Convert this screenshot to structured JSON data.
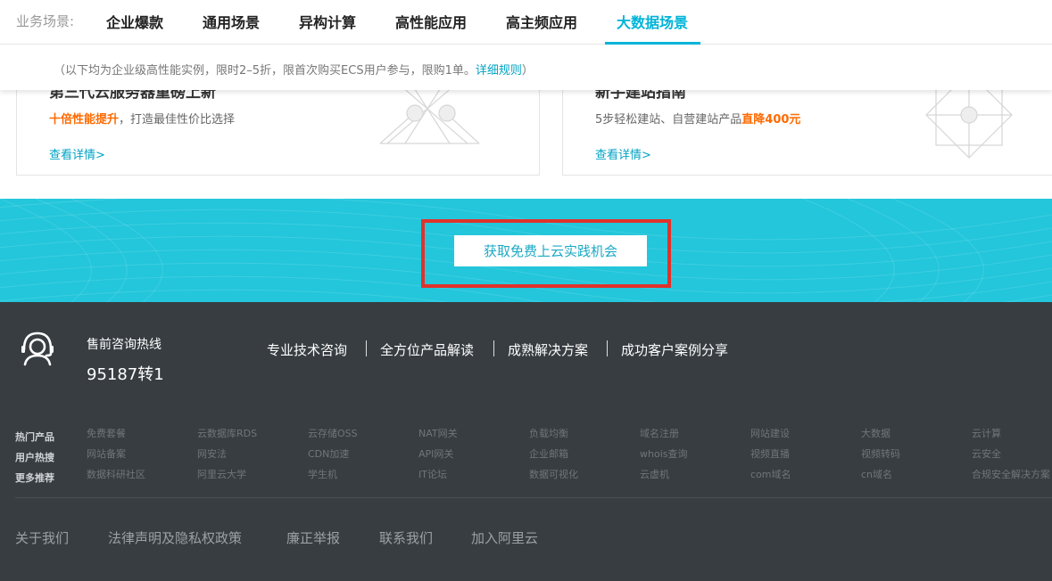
{
  "scenario_nav": {
    "label": "业务场景:",
    "tabs": [
      "企业爆款",
      "通用场景",
      "异构计算",
      "高性能应用",
      "高主频应用",
      "大数据场景"
    ],
    "active_tab": "大数据场景"
  },
  "notice": {
    "text": "（以下均为企业级高性能实例，限时2–5折，限首次购买ECS用户参与，限购1单。",
    "link": "详细规则",
    "suffix": "）"
  },
  "cards": [
    {
      "title": "第三代云服务器重磅上新",
      "desc_highlight": "十倍性能提升",
      "desc_rest": "，打造最佳性价比选择",
      "link": "查看详情>"
    },
    {
      "title": "新手建站指南",
      "desc_rest": "5步轻松建站、自营建站产品",
      "desc_highlight": "直降400元",
      "link": "查看详情>"
    }
  ],
  "cta": {
    "button_label": "获取免费上云实践机会"
  },
  "footer": {
    "hotline_label": "售前咨询热线",
    "hotline_number": "95187转1",
    "services": [
      "专业技术咨询",
      "全方位产品解读",
      "成熟解决方案",
      "成功客户案例分享"
    ],
    "categories": [
      "热门产品",
      "用户热搜",
      "更多推荐"
    ],
    "link_rows": [
      [
        "免费套餐",
        "云数据库RDS",
        "云存储OSS",
        "NAT网关",
        "负载均衡",
        "域名注册",
        "网站建设",
        "大数据",
        "云计算"
      ],
      [
        "网站备案",
        "网安法",
        "CDN加速",
        "API网关",
        "企业邮箱",
        "whois查询",
        "视频直播",
        "视频转码",
        "云安全"
      ],
      [
        "数据科研社区",
        "阿里云大学",
        "学生机",
        "IT论坛",
        "数据可视化",
        "云虚机",
        "com域名",
        "cn域名",
        "合规安全解决方案"
      ]
    ],
    "bottom_links": [
      "关于我们",
      "法律声明及隐私权政策",
      "廉正举报",
      "联系我们",
      "加入阿里云"
    ]
  },
  "colors": {
    "accent": "#00b4d8",
    "highlight": "#ff6a00",
    "cta_bg": "#23c6db",
    "footer_bg": "#373d41",
    "annotation_box": "#e0322b"
  }
}
